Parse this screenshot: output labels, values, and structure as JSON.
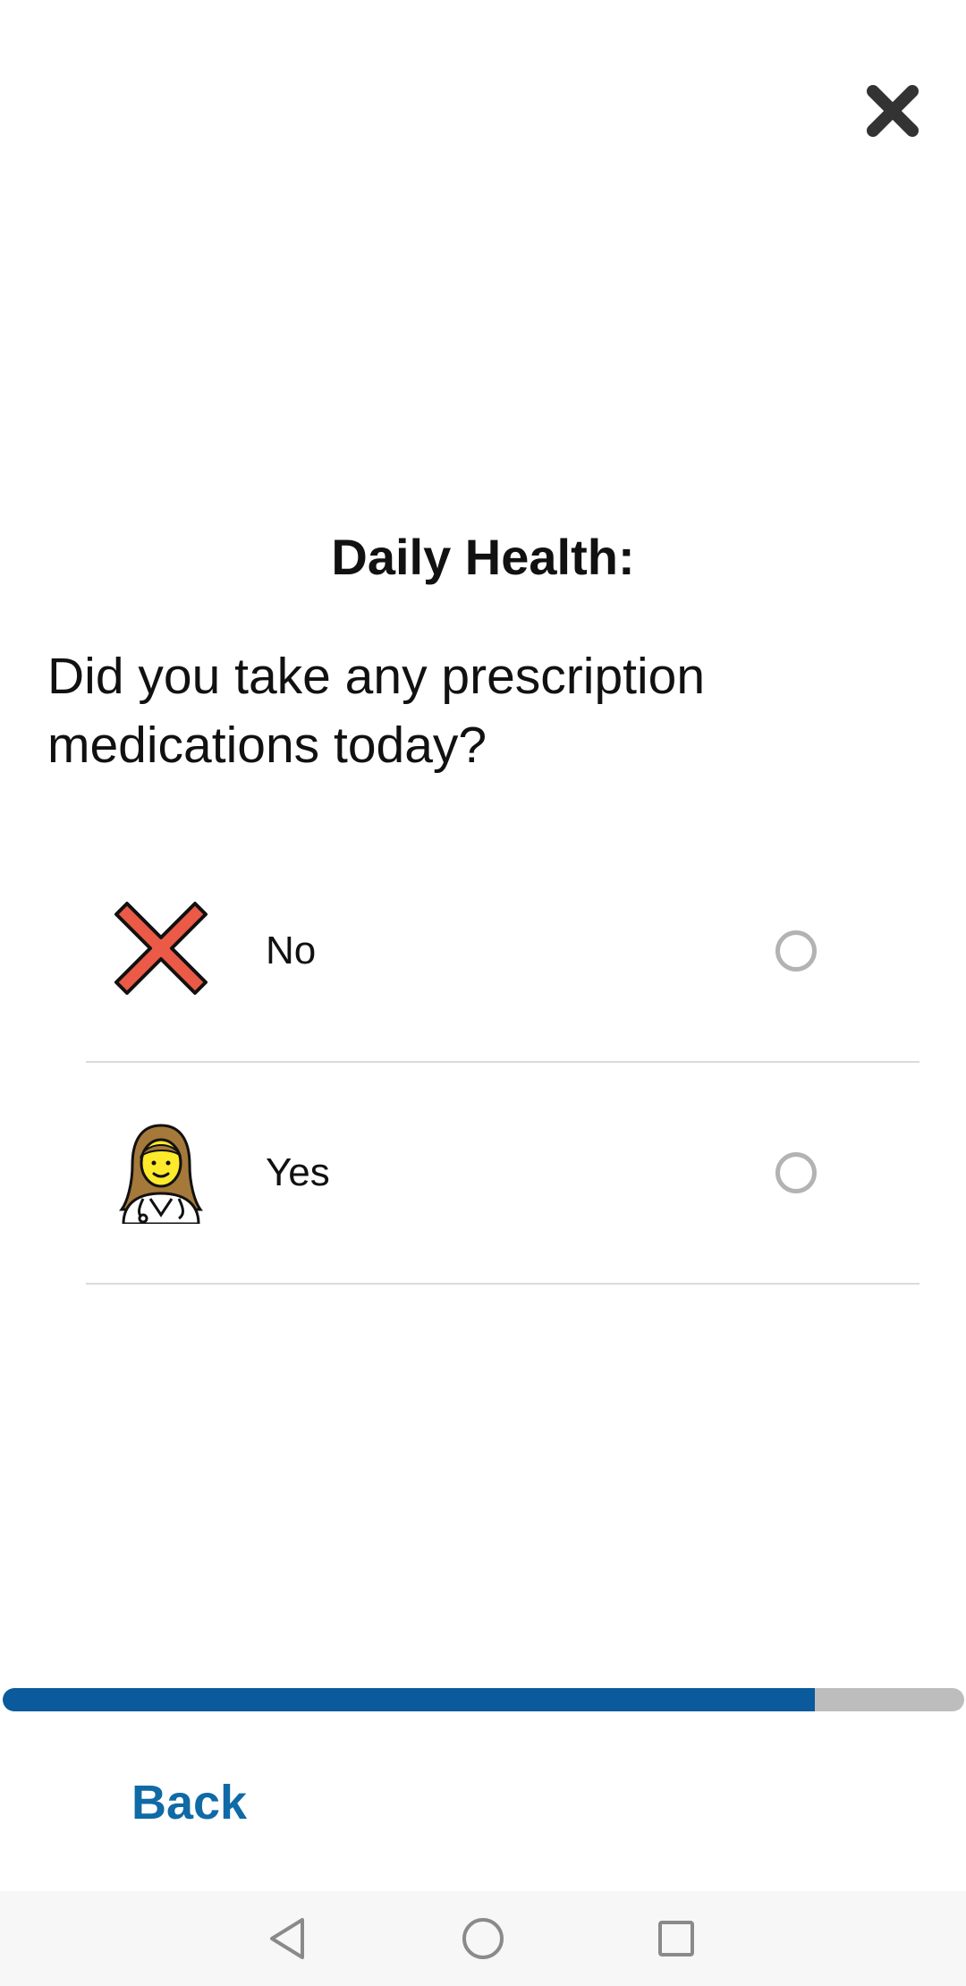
{
  "header": {
    "close_icon": "close-icon"
  },
  "survey": {
    "section_title": "Daily Health:",
    "question": "Did you take any prescription medications today?",
    "options": [
      {
        "label": "No",
        "icon": "red-x-icon",
        "selected": false
      },
      {
        "label": "Yes",
        "icon": "doctor-icon",
        "selected": false
      }
    ]
  },
  "progress": {
    "fraction": 0.845,
    "fill_color": "#0a5a9c",
    "track_color": "#bdbdbd"
  },
  "footer": {
    "back_label": "Back",
    "back_color": "#0f6aa6"
  },
  "system_nav": {
    "buttons": [
      "back-triangle-icon",
      "home-circle-icon",
      "recents-square-icon"
    ]
  }
}
